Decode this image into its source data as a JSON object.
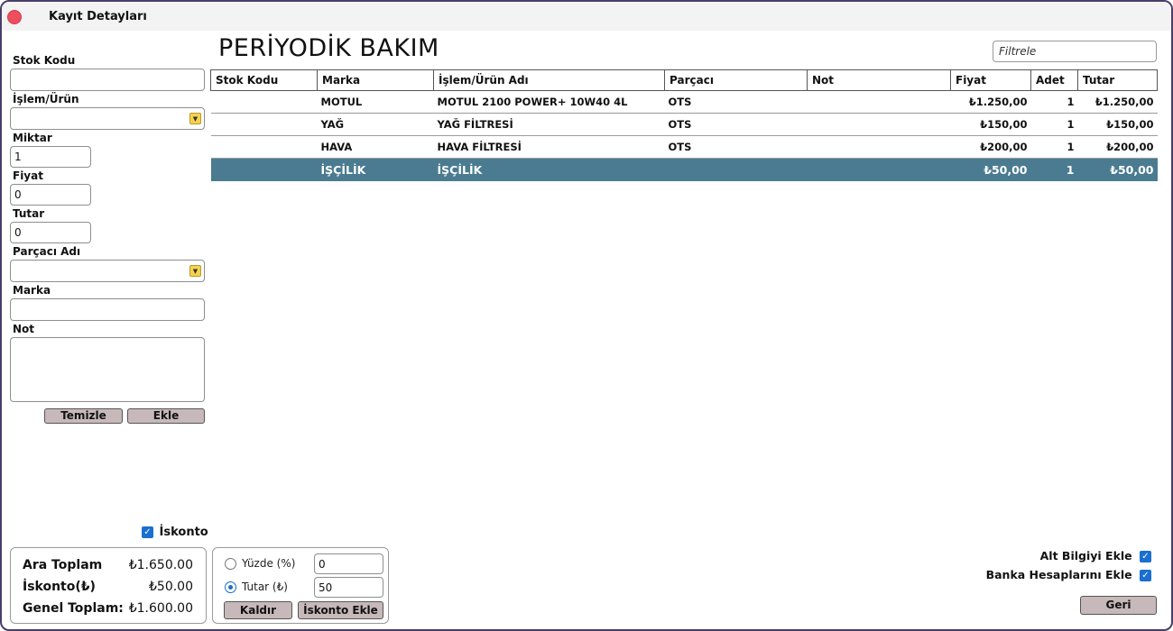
{
  "window": {
    "title": "Kayıt Detayları"
  },
  "form": {
    "stok_kodu_label": "Stok Kodu",
    "stok_kodu_value": "",
    "islem_label": "İşlem/Ürün",
    "islem_value": "",
    "miktar_label": "Miktar",
    "miktar_value": "1",
    "fiyat_label": "Fiyat",
    "fiyat_value": "0",
    "tutar_label": "Tutar",
    "tutar_value": "0",
    "parcaci_label": "Parçacı Adı",
    "parcaci_value": "",
    "marka_label": "Marka",
    "marka_value": "",
    "not_label": "Not",
    "not_value": "",
    "temizle_button": "Temizle",
    "ekle_button": "Ekle",
    "iskonto_checkbox_label": "İskonto",
    "iskonto_checked": true
  },
  "main": {
    "title": "PERİYODİK BAKIM",
    "filter_placeholder": "Filtrele"
  },
  "table": {
    "columns": [
      "Stok Kodu",
      "Marka",
      "İşlem/Ürün Adı",
      "Parçacı",
      "Not",
      "Fiyat",
      "Adet",
      "Tutar"
    ],
    "rows": [
      {
        "stok": "",
        "marka": "MOTUL",
        "urun": "MOTUL 2100 POWER+ 10W40 4L",
        "parcaci": "OTS",
        "not": "",
        "fiyat": "₺1.250,00",
        "adet": "1",
        "tutar": "₺1.250,00"
      },
      {
        "stok": "",
        "marka": "YAĞ",
        "urun": "YAĞ FİLTRESİ",
        "parcaci": "OTS",
        "not": "",
        "fiyat": "₺150,00",
        "adet": "1",
        "tutar": "₺150,00"
      },
      {
        "stok": "",
        "marka": "HAVA",
        "urun": "HAVA FİLTRESİ",
        "parcaci": "OTS",
        "not": "",
        "fiyat": "₺200,00",
        "adet": "1",
        "tutar": "₺200,00"
      },
      {
        "stok": "",
        "marka": "İŞÇİLİK",
        "urun": "İŞÇİLİK",
        "parcaci": "",
        "not": "",
        "fiyat": "₺50,00",
        "adet": "1",
        "tutar": "₺50,00"
      }
    ],
    "selected_row": 3
  },
  "totals": {
    "ara_label": "Ara Toplam",
    "ara_value": "₺1.650.00",
    "iskonto_label": "İskonto(₺)",
    "iskonto_value": "₺50.00",
    "genel_label": "Genel Toplam:",
    "genel_value": "₺1.600.00"
  },
  "discount": {
    "yuzde_label": "Yüzde (%)",
    "yuzde_value": "0",
    "tutar_label": "Tutar (₺)",
    "tutar_value": "50",
    "selected": "tutar",
    "kaldir_button": "Kaldır",
    "ekle_button": "İskonto Ekle"
  },
  "options": {
    "alt_bilgi_label": "Alt Bilgiyi Ekle",
    "alt_bilgi_checked": true,
    "banka_label": "Banka Hesaplarını Ekle",
    "banka_checked": true,
    "geri_button": "Geri"
  },
  "colors": {
    "selected_row": "#4a7b91",
    "button": "#c7b9b9",
    "checkbox": "#1a6fd1",
    "close": "#ef4e5c",
    "combo_arrow": "#f6d24e"
  }
}
